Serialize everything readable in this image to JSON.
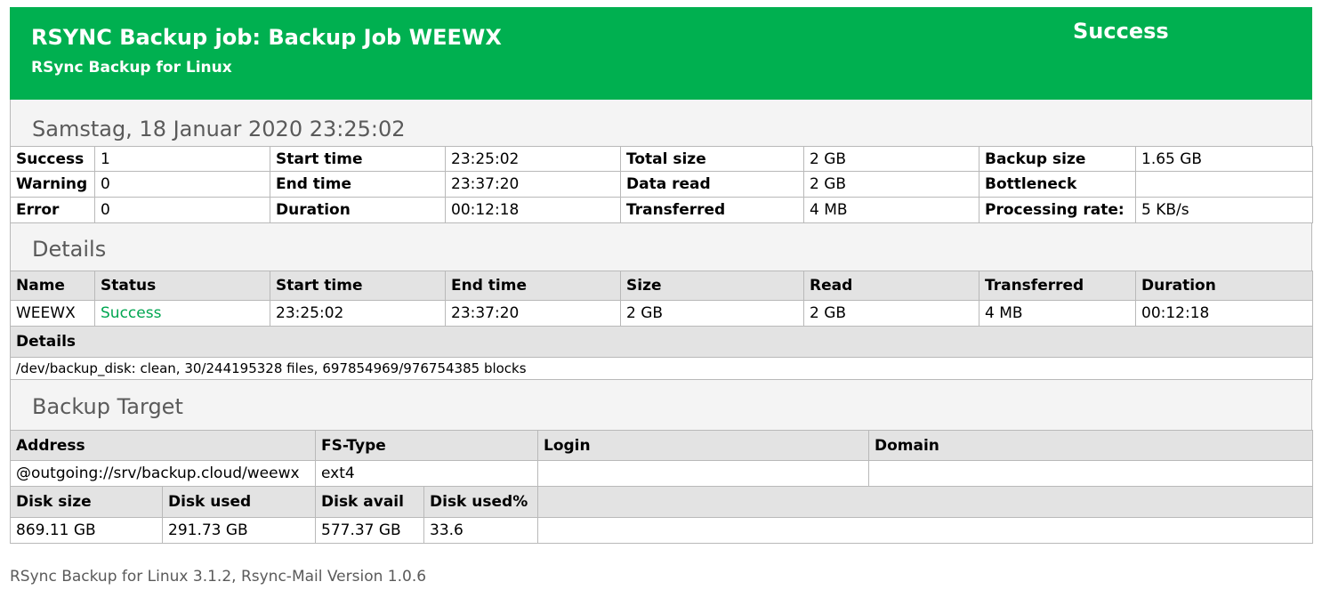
{
  "header": {
    "title": "RSYNC Backup job: Backup Job WEEWX",
    "subtitle": "RSync Backup for Linux",
    "status": "Success",
    "color": "#00b050"
  },
  "date": "Samstag, 18 Januar 2020 23:25:02",
  "summary": [
    [
      "Success",
      "1",
      "Start time",
      "23:25:02",
      "Total size",
      "2 GB",
      "Backup size",
      "1.65 GB"
    ],
    [
      "Warning",
      "0",
      "End time",
      "23:37:20",
      "Data read",
      "2 GB",
      "Bottleneck",
      ""
    ],
    [
      "Error",
      "0",
      "Duration",
      "00:12:18",
      "Transferred",
      "4 MB",
      "Processing rate:",
      "5 KB/s"
    ]
  ],
  "details": {
    "heading": "Details",
    "columns": [
      "Name",
      "Status",
      "Start time",
      "End time",
      "Size",
      "Read",
      "Transferred",
      "Duration"
    ],
    "row": [
      "WEEWX",
      "Success",
      "23:25:02",
      "23:37:20",
      "2 GB",
      "2 GB",
      "4 MB",
      "00:12:18"
    ],
    "sub_label": "Details",
    "log": "/dev/backup_disk: clean, 30/244195328 files, 697854969/976754385 blocks",
    "status_color": "#00a651"
  },
  "target": {
    "heading": "Backup Target",
    "columns": [
      "Address",
      "FS-Type",
      "Login",
      "Domain"
    ],
    "row": [
      "@outgoing://srv/backup.cloud/weewx",
      "ext4",
      "",
      ""
    ],
    "disk_columns": [
      "Disk size",
      "Disk used",
      "Disk avail",
      "Disk used%"
    ],
    "disk_row": [
      "869.11 GB",
      "291.73 GB",
      "577.37 GB",
      "33.6"
    ]
  },
  "footer": "RSync Backup for Linux 3.1.2, Rsync-Mail Version 1.0.6"
}
